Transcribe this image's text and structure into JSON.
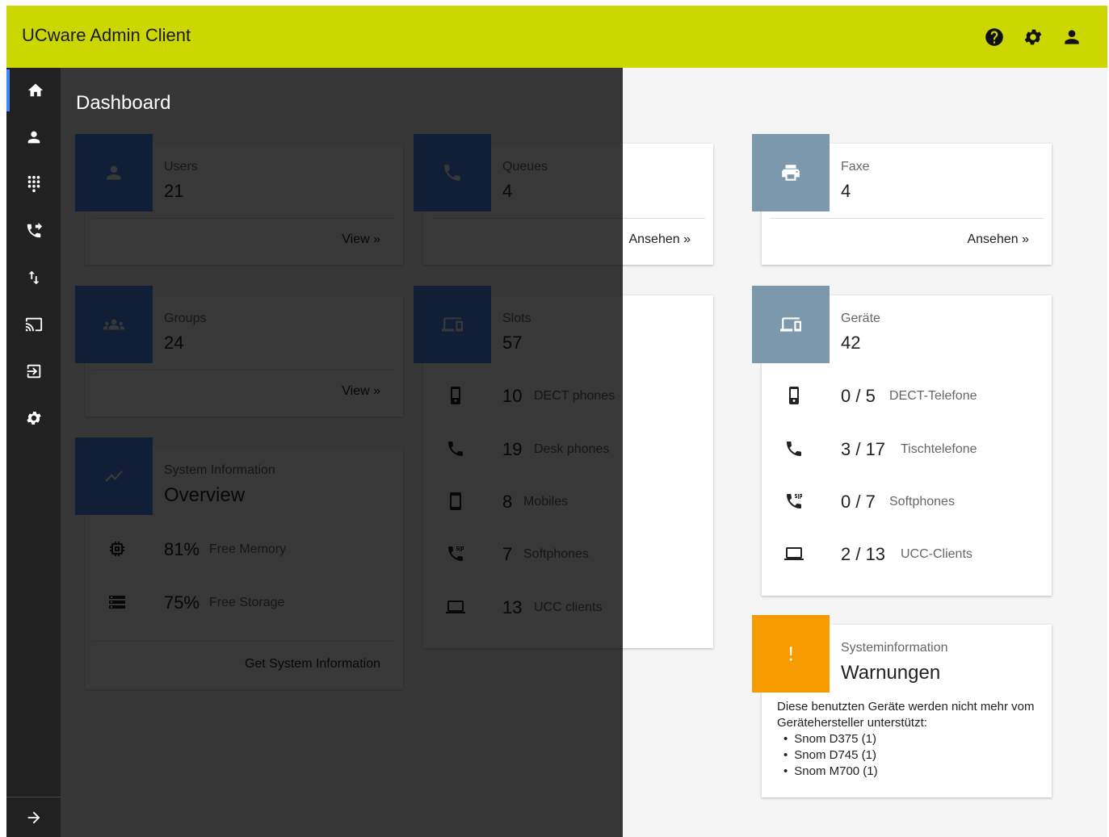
{
  "app": {
    "title": "UCware Admin Client"
  },
  "page": {
    "title": "Dashboard"
  },
  "cards": {
    "users": {
      "label": "Users",
      "value": "21",
      "link": "View »"
    },
    "queues": {
      "label": "Queues",
      "value": "4",
      "link": "Ansehen »"
    },
    "faxe": {
      "label": "Faxe",
      "value": "4",
      "link": "Ansehen »"
    },
    "groups": {
      "label": "Groups",
      "value": "24",
      "link": "View »"
    },
    "slots": {
      "label": "Slots",
      "value": "57",
      "rows": [
        {
          "value": "10",
          "label": "DECT phones"
        },
        {
          "value": "19",
          "label": "Desk phones"
        },
        {
          "value": "8",
          "label": "Mobiles"
        },
        {
          "value": "7",
          "label": "Softphones"
        },
        {
          "value": "13",
          "label": "UCC clients"
        }
      ]
    },
    "geraete": {
      "label": "Geräte",
      "value": "42",
      "rows": [
        {
          "value": "0 / 5",
          "label": "DECT-Telefone"
        },
        {
          "value": "3 / 17",
          "label": "Tischtelefone"
        },
        {
          "value": "0 / 7",
          "label": "Softphones"
        },
        {
          "value": "2 / 13",
          "label": "UCC-Clients"
        }
      ]
    },
    "sysinfo": {
      "label": "System Information",
      "value": "Overview",
      "rows": [
        {
          "value": "81%",
          "label": "Free Memory"
        },
        {
          "value": "75%",
          "label": "Free Storage"
        }
      ],
      "link": "Get System Information"
    },
    "warnings": {
      "label": "Systeminformation",
      "value": "Warnungen",
      "text": "Diese benutzten Geräte werden nicht mehr vom Gerätehersteller unterstützt:",
      "items": [
        "Snom D375 (1)",
        "Snom D745 (1)",
        "Snom M700 (1)"
      ]
    }
  },
  "colors": {
    "topbar": "#ccd600",
    "sidebar": "#212121",
    "accent_blue": "#4a8af4",
    "accent_gray": "#7b98ad",
    "accent_orange": "#f79c00"
  }
}
